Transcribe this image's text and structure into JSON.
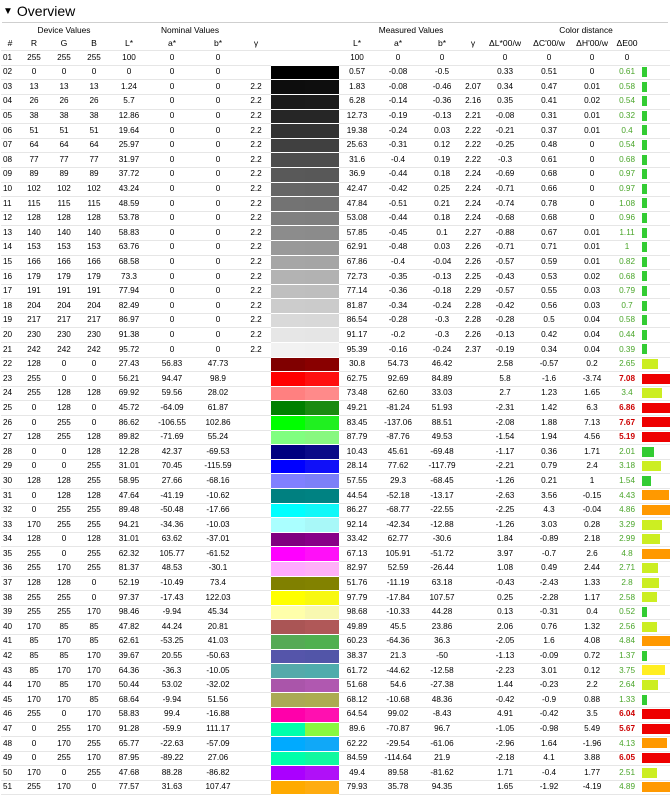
{
  "section": {
    "title": "Overview"
  },
  "groups": {
    "device": "Device Values",
    "nominal": "Nominal Values",
    "measured": "Measured Values",
    "color_distance": "Color distance"
  },
  "columns": {
    "num": "#",
    "r": "R",
    "g": "G",
    "b": "B",
    "nom_l": "L*",
    "nom_a": "a*",
    "nom_b": "b*",
    "nom_g": "γ",
    "mes_l": "L*",
    "mes_a": "a*",
    "mes_b": "b*",
    "mes_g": "γ",
    "dl": "ΔL*00/w",
    "dc": "ΔC'00/w",
    "dh": "ΔH'00/w",
    "de": "ΔE00"
  },
  "colors": {
    "good": "#33cc33",
    "warn_yellow": "#ccee22",
    "warn_orange": "#ff9900",
    "bad": "#ee0000"
  },
  "rows": [
    [
      "01",
      "255",
      "255",
      "255",
      "100",
      "0",
      "0",
      "",
      "#ffffff",
      "#ffffff",
      "100",
      "0",
      "0",
      "",
      "0",
      "0",
      "0",
      "0",
      "#ffffff"
    ],
    [
      "02",
      "0",
      "0",
      "0",
      "0",
      "0",
      "0",
      "",
      "#000000",
      "#000000",
      "0.57",
      "-0.08",
      "-0.5",
      "",
      "0.33",
      "0.51",
      "0",
      "0.61",
      "#33cc33"
    ],
    [
      "03",
      "13",
      "13",
      "13",
      "1.24",
      "0",
      "0",
      "2.2",
      "#0d0d0d",
      "#0e0e0e",
      "1.83",
      "-0.08",
      "-0.46",
      "2.07",
      "0.34",
      "0.47",
      "0.01",
      "0.58",
      "#33cc33"
    ],
    [
      "04",
      "26",
      "26",
      "26",
      "5.7",
      "0",
      "0",
      "2.2",
      "#1a1a1a",
      "#1b1b1b",
      "6.28",
      "-0.14",
      "-0.36",
      "2.16",
      "0.35",
      "0.41",
      "0.02",
      "0.54",
      "#33cc33"
    ],
    [
      "05",
      "38",
      "38",
      "38",
      "12.86",
      "0",
      "0",
      "2.2",
      "#262626",
      "#262626",
      "12.73",
      "-0.19",
      "-0.13",
      "2.21",
      "-0.08",
      "0.31",
      "0.01",
      "0.32",
      "#33cc33"
    ],
    [
      "06",
      "51",
      "51",
      "51",
      "19.64",
      "0",
      "0",
      "2.2",
      "#333333",
      "#333333",
      "19.38",
      "-0.24",
      "0.03",
      "2.22",
      "-0.21",
      "0.37",
      "0.01",
      "0.4",
      "#33cc33"
    ],
    [
      "07",
      "64",
      "64",
      "64",
      "25.97",
      "0",
      "0",
      "2.2",
      "#404040",
      "#404040",
      "25.63",
      "-0.31",
      "0.12",
      "2.22",
      "-0.25",
      "0.48",
      "0",
      "0.54",
      "#33cc33"
    ],
    [
      "08",
      "77",
      "77",
      "77",
      "31.97",
      "0",
      "0",
      "2.2",
      "#4d4d4d",
      "#4d4d4d",
      "31.6",
      "-0.4",
      "0.19",
      "2.22",
      "-0.3",
      "0.61",
      "0",
      "0.68",
      "#33cc33"
    ],
    [
      "09",
      "89",
      "89",
      "89",
      "37.72",
      "0",
      "0",
      "2.2",
      "#595959",
      "#585858",
      "36.9",
      "-0.44",
      "0.18",
      "2.24",
      "-0.69",
      "0.68",
      "0",
      "0.97",
      "#33cc33"
    ],
    [
      "10",
      "102",
      "102",
      "102",
      "43.24",
      "0",
      "0",
      "2.2",
      "#666666",
      "#656565",
      "42.47",
      "-0.42",
      "0.25",
      "2.24",
      "-0.71",
      "0.66",
      "0",
      "0.97",
      "#33cc33"
    ],
    [
      "11",
      "115",
      "115",
      "115",
      "48.59",
      "0",
      "0",
      "2.2",
      "#737373",
      "#727272",
      "47.84",
      "-0.51",
      "0.21",
      "2.24",
      "-0.74",
      "0.78",
      "0",
      "1.08",
      "#33cc33"
    ],
    [
      "12",
      "128",
      "128",
      "128",
      "53.78",
      "0",
      "0",
      "2.2",
      "#808080",
      "#7f7f7f",
      "53.08",
      "-0.44",
      "0.18",
      "2.24",
      "-0.68",
      "0.68",
      "0",
      "0.96",
      "#33cc33"
    ],
    [
      "13",
      "140",
      "140",
      "140",
      "58.83",
      "0",
      "0",
      "2.2",
      "#8c8c8c",
      "#8b8b8b",
      "57.85",
      "-0.45",
      "0.1",
      "2.27",
      "-0.88",
      "0.67",
      "0.01",
      "1.11",
      "#33cc33"
    ],
    [
      "14",
      "153",
      "153",
      "153",
      "63.76",
      "0",
      "0",
      "2.2",
      "#999999",
      "#989898",
      "62.91",
      "-0.48",
      "0.03",
      "2.26",
      "-0.71",
      "0.71",
      "0.01",
      "1",
      "#33cc33"
    ],
    [
      "15",
      "166",
      "166",
      "166",
      "68.58",
      "0",
      "0",
      "2.2",
      "#a6a6a6",
      "#a5a5a5",
      "67.86",
      "-0.4",
      "-0.04",
      "2.26",
      "-0.57",
      "0.59",
      "0.01",
      "0.82",
      "#33cc33"
    ],
    [
      "16",
      "179",
      "179",
      "179",
      "73.3",
      "0",
      "0",
      "2.2",
      "#b3b3b3",
      "#b2b2b2",
      "72.73",
      "-0.35",
      "-0.13",
      "2.25",
      "-0.43",
      "0.53",
      "0.02",
      "0.68",
      "#33cc33"
    ],
    [
      "17",
      "191",
      "191",
      "191",
      "77.94",
      "0",
      "0",
      "2.2",
      "#bfbfbf",
      "#bebebe",
      "77.14",
      "-0.36",
      "-0.18",
      "2.29",
      "-0.57",
      "0.55",
      "0.03",
      "0.79",
      "#33cc33"
    ],
    [
      "18",
      "204",
      "204",
      "204",
      "82.49",
      "0",
      "0",
      "2.2",
      "#cccccc",
      "#cbcbcb",
      "81.87",
      "-0.34",
      "-0.24",
      "2.28",
      "-0.42",
      "0.56",
      "0.03",
      "0.7",
      "#33cc33"
    ],
    [
      "19",
      "217",
      "217",
      "217",
      "86.97",
      "0",
      "0",
      "2.2",
      "#d9d9d9",
      "#d8d8d8",
      "86.54",
      "-0.28",
      "-0.3",
      "2.28",
      "-0.28",
      "0.5",
      "0.04",
      "0.58",
      "#33cc33"
    ],
    [
      "20",
      "230",
      "230",
      "230",
      "91.38",
      "0",
      "0",
      "2.2",
      "#e6e6e6",
      "#e5e5e5",
      "91.17",
      "-0.2",
      "-0.3",
      "2.26",
      "-0.13",
      "0.42",
      "0.04",
      "0.44",
      "#33cc33"
    ],
    [
      "21",
      "242",
      "242",
      "242",
      "95.72",
      "0",
      "0",
      "2.2",
      "#f2f2f2",
      "#f1f1f1",
      "95.39",
      "-0.16",
      "-0.24",
      "2.37",
      "-0.19",
      "0.34",
      "0.04",
      "0.39",
      "#33cc33"
    ],
    [
      "22",
      "128",
      "0",
      "0",
      "27.43",
      "56.83",
      "47.73",
      "",
      "#800000",
      "#890000",
      "30.8",
      "54.73",
      "46.42",
      "",
      "2.58",
      "-0.57",
      "0.2",
      "2.65",
      "#ccee22"
    ],
    [
      "23",
      "255",
      "0",
      "0",
      "56.21",
      "94.47",
      "98.9",
      "",
      "#ff0000",
      "#ff1010",
      "62.75",
      "92.69",
      "84.89",
      "",
      "5.8",
      "-1.6",
      "-3.74",
      "7.08",
      "#ee0000"
    ],
    [
      "24",
      "255",
      "128",
      "128",
      "69.92",
      "59.56",
      "28.02",
      "",
      "#ff8080",
      "#ff8a8a",
      "73.48",
      "62.60",
      "33.03",
      "",
      "2.7",
      "1.23",
      "1.65",
      "3.4",
      "#ccee22"
    ],
    [
      "25",
      "0",
      "128",
      "0",
      "45.72",
      "-64.09",
      "61.87",
      "",
      "#008000",
      "#1a8a10",
      "49.21",
      "-81.24",
      "51.93",
      "",
      "-2.31",
      "1.42",
      "6.3",
      "6.86",
      "#ee0000"
    ],
    [
      "26",
      "0",
      "255",
      "0",
      "86.62",
      "-106.55",
      "102.86",
      "",
      "#00ff00",
      "#20f020",
      "83.45",
      "-137.06",
      "88.51",
      "",
      "-2.08",
      "1.88",
      "7.13",
      "7.67",
      "#ee0000"
    ],
    [
      "27",
      "128",
      "255",
      "128",
      "89.82",
      "-71.69",
      "55.24",
      "",
      "#80ff80",
      "#88f880",
      "87.79",
      "-87.76",
      "49.53",
      "",
      "-1.54",
      "1.94",
      "4.56",
      "5.19",
      "#ee0000"
    ],
    [
      "28",
      "0",
      "0",
      "128",
      "12.28",
      "42.37",
      "-69.53",
      "",
      "#000080",
      "#0a0a88",
      "10.43",
      "45.61",
      "-69.48",
      "",
      "-1.17",
      "0.36",
      "1.71",
      "2.01",
      "#33cc33"
    ],
    [
      "29",
      "0",
      "0",
      "255",
      "31.01",
      "70.45",
      "-115.59",
      "",
      "#0000ff",
      "#1010f8",
      "28.14",
      "77.62",
      "-117.79",
      "",
      "-2.21",
      "0.79",
      "2.4",
      "3.18",
      "#ccee22"
    ],
    [
      "30",
      "128",
      "128",
      "255",
      "58.95",
      "27.66",
      "-68.16",
      "",
      "#8080ff",
      "#7c80f8",
      "57.55",
      "29.3",
      "-68.45",
      "",
      "-1.26",
      "0.21",
      "1",
      "1.54",
      "#33cc33"
    ],
    [
      "31",
      "0",
      "128",
      "128",
      "47.64",
      "-41.19",
      "-10.62",
      "",
      "#008080",
      "#008282",
      "44.54",
      "-52.18",
      "-13.17",
      "",
      "-2.63",
      "3.56",
      "-0.15",
      "4.43",
      "#ff9900"
    ],
    [
      "32",
      "0",
      "255",
      "255",
      "89.48",
      "-50.48",
      "-17.66",
      "",
      "#00ffff",
      "#10f8f8",
      "86.27",
      "-68.77",
      "-22.55",
      "",
      "-2.25",
      "4.3",
      "-0.04",
      "4.86",
      "#ff9900"
    ],
    [
      "33",
      "170",
      "255",
      "255",
      "94.21",
      "-34.36",
      "-10.03",
      "",
      "#aaffff",
      "#a8f8f8",
      "92.14",
      "-42.34",
      "-12.88",
      "",
      "-1.26",
      "3.03",
      "0.28",
      "3.29",
      "#ccee22"
    ],
    [
      "34",
      "128",
      "0",
      "128",
      "31.01",
      "63.62",
      "-37.01",
      "",
      "#800080",
      "#880088",
      "33.42",
      "62.77",
      "-30.6",
      "",
      "1.84",
      "-0.89",
      "2.18",
      "2.99",
      "#ccee22"
    ],
    [
      "35",
      "255",
      "0",
      "255",
      "62.32",
      "105.77",
      "-61.52",
      "",
      "#ff00ff",
      "#ff10f8",
      "67.13",
      "105.91",
      "-51.72",
      "",
      "3.97",
      "-0.7",
      "2.6",
      "4.8",
      "#ff9900"
    ],
    [
      "36",
      "255",
      "170",
      "255",
      "81.37",
      "48.53",
      "-30.1",
      "",
      "#ffaaff",
      "#ffb0f8",
      "82.97",
      "52.59",
      "-26.44",
      "",
      "1.08",
      "0.49",
      "2.44",
      "2.71",
      "#ccee22"
    ],
    [
      "37",
      "128",
      "128",
      "0",
      "52.19",
      "-10.49",
      "73.4",
      "",
      "#808000",
      "#828200",
      "51.76",
      "-11.19",
      "63.18",
      "",
      "-0.43",
      "-2.43",
      "1.33",
      "2.8",
      "#ccee22"
    ],
    [
      "38",
      "255",
      "255",
      "0",
      "97.37",
      "-17.43",
      "122.03",
      "",
      "#ffff00",
      "#f8f810",
      "97.79",
      "-17.84",
      "107.57",
      "",
      "0.25",
      "-2.28",
      "1.17",
      "2.58",
      "#ccee22"
    ],
    [
      "39",
      "255",
      "255",
      "170",
      "98.46",
      "-9.94",
      "45.34",
      "",
      "#ffffaa",
      "#f8f8b0",
      "98.68",
      "-10.33",
      "44.28",
      "",
      "0.13",
      "-0.31",
      "0.4",
      "0.52",
      "#33cc33"
    ],
    [
      "40",
      "170",
      "85",
      "85",
      "47.82",
      "44.24",
      "20.81",
      "",
      "#aa5555",
      "#b05858",
      "49.89",
      "45.5",
      "23.86",
      "",
      "2.06",
      "0.76",
      "1.32",
      "2.56",
      "#ccee22"
    ],
    [
      "41",
      "85",
      "170",
      "85",
      "62.61",
      "-53.25",
      "41.03",
      "",
      "#55aa55",
      "#50b050",
      "60.23",
      "-64.36",
      "36.3",
      "",
      "-2.05",
      "1.6",
      "4.08",
      "4.84",
      "#ff9900"
    ],
    [
      "42",
      "85",
      "85",
      "170",
      "39.67",
      "20.55",
      "-50.63",
      "",
      "#5555aa",
      "#5255a8",
      "38.37",
      "21.3",
      "-50",
      "",
      "-1.13",
      "-0.09",
      "0.72",
      "1.37",
      "#33cc33"
    ],
    [
      "43",
      "85",
      "170",
      "170",
      "64.36",
      "-36.3",
      "-10.05",
      "",
      "#55aaaa",
      "#50acac",
      "61.72",
      "-44.62",
      "-12.58",
      "",
      "-2.23",
      "3.01",
      "0.12",
      "3.75",
      "#ffee22"
    ],
    [
      "44",
      "170",
      "85",
      "170",
      "50.44",
      "53.02",
      "-32.02",
      "",
      "#aa55aa",
      "#b058b0",
      "51.68",
      "54.6",
      "-27.38",
      "",
      "1.44",
      "-0.23",
      "2.2",
      "2.64",
      "#ccee22"
    ],
    [
      "45",
      "170",
      "170",
      "85",
      "68.64",
      "-9.94",
      "51.56",
      "",
      "#aaaa55",
      "#acac50",
      "68.12",
      "-10.68",
      "48.36",
      "",
      "-0.42",
      "-0.9",
      "0.88",
      "1.33",
      "#33cc33"
    ],
    [
      "46",
      "255",
      "0",
      "170",
      "58.83",
      "99.4",
      "-16.88",
      "",
      "#ff00aa",
      "#ff10b0",
      "64.54",
      "99.02",
      "-8.43",
      "",
      "4.91",
      "-0.42",
      "3.5",
      "6.04",
      "#ee0000"
    ],
    [
      "47",
      "0",
      "255",
      "170",
      "91.28",
      "-59.9",
      "111.17",
      "",
      "#00ffaa",
      "#88f840",
      "89.6",
      "-70.87",
      "96.7",
      "",
      "-1.05",
      "-0.98",
      "5.49",
      "5.67",
      "#ee0000"
    ],
    [
      "48",
      "0",
      "170",
      "255",
      "65.77",
      "-22.63",
      "-57.09",
      "",
      "#00aaff",
      "#10a8f8",
      "62.22",
      "-29.54",
      "-61.06",
      "",
      "-2.96",
      "1.64",
      "-1.96",
      "4.13",
      "#ff9900"
    ],
    [
      "49",
      "0",
      "255",
      "170",
      "87.95",
      "-89.22",
      "27.06",
      "",
      "#00ffaa",
      "#10f8a0",
      "84.59",
      "-114.64",
      "21.9",
      "",
      "-2.18",
      "4.1",
      "3.88",
      "6.05",
      "#ee0000"
    ],
    [
      "50",
      "170",
      "0",
      "255",
      "47.68",
      "88.28",
      "-86.82",
      "",
      "#aa00ff",
      "#b010f8",
      "49.4",
      "89.58",
      "-81.62",
      "",
      "1.71",
      "-0.4",
      "1.77",
      "2.51",
      "#ccee22"
    ],
    [
      "51",
      "255",
      "170",
      "0",
      "77.57",
      "31.63",
      "107.47",
      "",
      "#ffaa00",
      "#ffac10",
      "79.93",
      "35.78",
      "94.35",
      "",
      "1.65",
      "-1.92",
      "-4.19",
      "4.89",
      "#ff9900"
    ]
  ]
}
